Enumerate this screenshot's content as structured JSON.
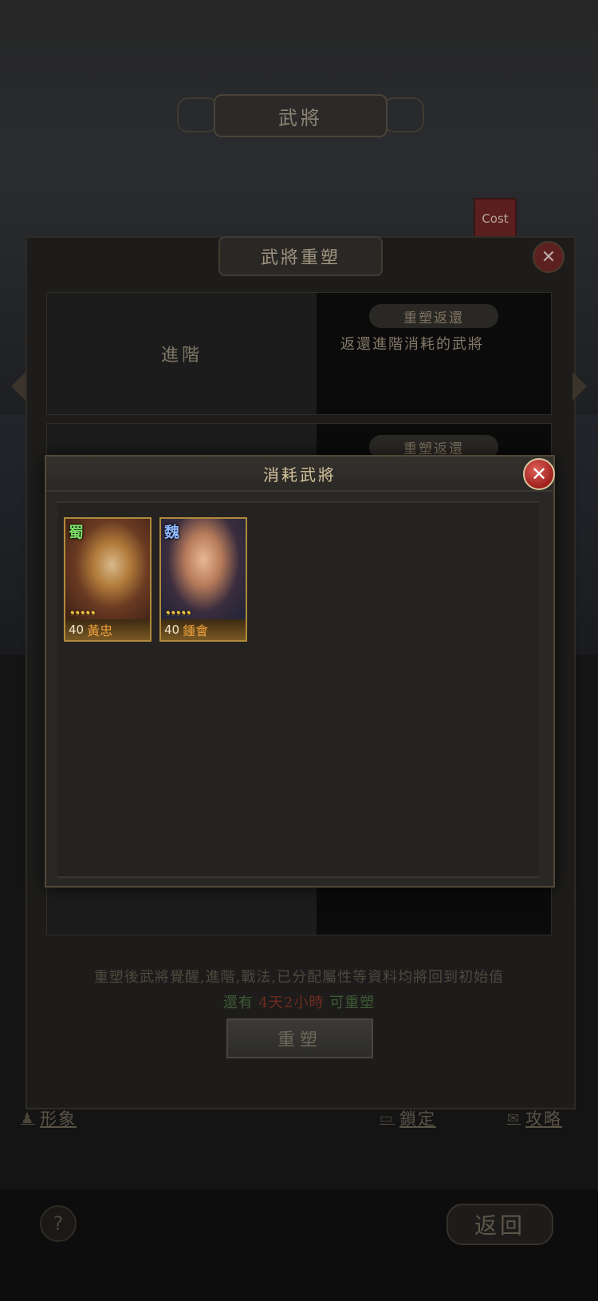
{
  "screen": {
    "title": "武將"
  },
  "cost_tag": "Cost",
  "panel": {
    "title": "武將重塑",
    "close_icon": "close-icon",
    "rows": [
      {
        "left_label": "進階",
        "pill": "重塑返還",
        "desc": "返還進階消耗的武將"
      },
      {
        "left_label": "",
        "pill": "重塑返還",
        "desc": ""
      }
    ],
    "hint": "重塑後武將覺醒,進階,戰法,已分配屬性等資料均將回到初始值",
    "countdown_prefix": "還有",
    "countdown_value": "4天2小時",
    "countdown_suffix": "可重塑",
    "reshape_button": "重塑"
  },
  "bottom_bar": {
    "image_label": "形象",
    "lock_label": "鎖定",
    "guide_label": "攻略",
    "help_label": "?",
    "return_label": "返回"
  },
  "modal": {
    "title": "消耗武將",
    "close_glyph": "✕",
    "generals": [
      {
        "faction": "蜀",
        "level": "40",
        "name": "黃忠",
        "stars": 5,
        "star_glyphs": "❟❟❟❟❟"
      },
      {
        "faction": "魏",
        "level": "40",
        "name": "鍾會",
        "stars": 5,
        "star_glyphs": "❟❟❟❟❟"
      }
    ]
  },
  "colors": {
    "accent_gold": "#d7c59d",
    "close_red": "#c0302a",
    "frame_gold": "#b08a3b"
  }
}
